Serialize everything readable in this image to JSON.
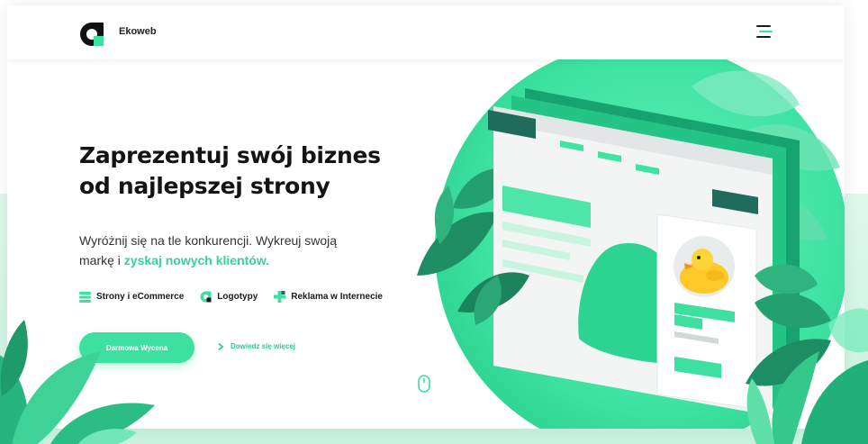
{
  "header": {
    "brand_name": "Ekoweb",
    "logo_icon": "ekoweb-logo-icon",
    "menu_icon": "menu-icon"
  },
  "hero": {
    "heading_line1": "Zaprezentuj swój biznes",
    "heading_line2": "od najlepszej strony",
    "subtitle_part1": "Wyróżnij się na tle konkurencji. Wykreuj swoją marką i ",
    "subtitle_part1_display": "Wyróżnij się na tle konkurencji. Wykreuj swoją",
    "subtitle_part2": "markę i ",
    "subtitle_highlight": "zyskaj nowych klientów."
  },
  "services": [
    {
      "label": "Strony i eCommerce",
      "icon": "web-pages-icon"
    },
    {
      "label": "Logotypy",
      "icon": "logo-design-icon"
    },
    {
      "label": "Reklama w Internecie",
      "icon": "advertising-icon"
    }
  ],
  "actions": {
    "cta_label": "Darmowa Wycena",
    "more_label": "Dowiedz się więcej",
    "more_icon": "chevron-right-icon",
    "scroll_icon": "mouse-scroll-icon"
  },
  "colors": {
    "accent": "#3ee0a0",
    "accent_dark": "#2ec98e",
    "dark_green": "#1f6b5c",
    "text": "#141414"
  }
}
